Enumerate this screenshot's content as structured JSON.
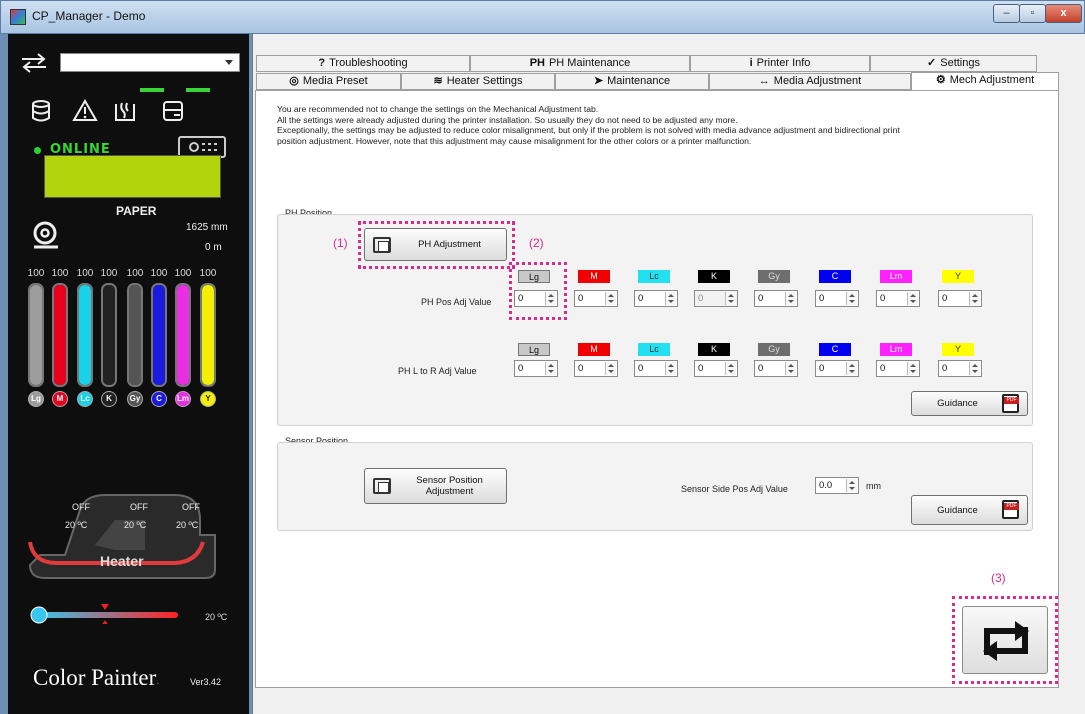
{
  "window": {
    "title": "CP_Manager - Demo",
    "close_glyph": "x",
    "min_glyph": "–",
    "max_glyph": "▫"
  },
  "left_panel": {
    "status": "ONLINE",
    "media_label": "PAPER",
    "media_length": "1625  mm",
    "media_remaining": "0  m",
    "inks": [
      {
        "code": "Lg",
        "level": "100",
        "color": "#9c9c9c",
        "fraction": 1.0
      },
      {
        "code": "M",
        "level": "100",
        "color": "#e8001c",
        "fraction": 1.0
      },
      {
        "code": "Lc",
        "level": "100",
        "color": "#19d2e8",
        "fraction": 1.0
      },
      {
        "code": "K",
        "level": "100",
        "color": "#222222",
        "fraction": 1.0
      },
      {
        "code": "Gy",
        "level": "100",
        "color": "#555555",
        "fraction": 1.0
      },
      {
        "code": "C",
        "level": "100",
        "color": "#1a1ae0",
        "fraction": 1.0
      },
      {
        "code": "Lm",
        "level": "100",
        "color": "#ea2ee4",
        "fraction": 1.0
      },
      {
        "code": "Y",
        "level": "100",
        "color": "#f2f000",
        "fraction": 1.0
      }
    ],
    "heaters": [
      {
        "state": "OFF",
        "temp": "20 ºC"
      },
      {
        "state": "OFF",
        "temp": "20 ºC"
      },
      {
        "state": "OFF",
        "temp": "20 ºC"
      }
    ],
    "heater_title": "Heater",
    "slider_temp": "20 ºC",
    "logo": "Color Painter",
    "logo_tail": ".",
    "version": "Ver3.42"
  },
  "tabs_row1": [
    {
      "label": "Troubleshooting",
      "icon": "?"
    },
    {
      "label": "PH Maintenance",
      "icon": "PH"
    },
    {
      "label": "Printer Info",
      "icon": "i"
    },
    {
      "label": "Settings",
      "icon": "✓"
    }
  ],
  "tabs_row2": [
    {
      "label": "Media Preset",
      "icon": "◎"
    },
    {
      "label": "Heater Settings",
      "icon": "≋"
    },
    {
      "label": "Maintenance",
      "icon": "➤"
    },
    {
      "label": "Media Adjustment",
      "icon": "↔"
    },
    {
      "label": "Mech Adjustment",
      "icon": "⚙"
    }
  ],
  "notice": [
    "You are recommended not to change the settings on the Mechanical Adjustment tab.",
    "All the settings were already adjusted during the printer installation. So usually they do not need to be adjusted any more.",
    "Exceptionally, the settings may be adjusted to reduce color misalignment, but only if the problem is not solved with media advance adjustment and bidirectional print",
    "position adjustment. However, note that this adjustment may cause misalignment for the other colors or a printer malfunction."
  ],
  "ph_position": {
    "title": "PH Position",
    "adjust_button": "PH Adjustment",
    "colors": [
      {
        "code": "Lg",
        "bg": "#c8c8c8",
        "fg": "#111111"
      },
      {
        "code": "M",
        "bg": "#f00000",
        "fg": "#ffffff"
      },
      {
        "code": "Lc",
        "bg": "#22e0f0",
        "fg": "#333333"
      },
      {
        "code": "K",
        "bg": "#000000",
        "fg": "#ffffff"
      },
      {
        "code": "Gy",
        "bg": "#6e6e6e",
        "fg": "#dddddd"
      },
      {
        "code": "C",
        "bg": "#0000f0",
        "fg": "#ffffff"
      },
      {
        "code": "Lm",
        "bg": "#ff22ff",
        "fg": "#ffffff"
      },
      {
        "code": "Y",
        "bg": "#ffff00",
        "fg": "#333333"
      }
    ],
    "pos_label": "PH Pos Adj Value",
    "pos_values": [
      "0",
      "0",
      "0",
      "0",
      "0",
      "0",
      "0",
      "0"
    ],
    "pos_disabled": [
      false,
      false,
      false,
      true,
      false,
      false,
      false,
      false
    ],
    "lr_label": "PH L to R Adj Value",
    "lr_values": [
      "0",
      "0",
      "0",
      "0",
      "0",
      "0",
      "0",
      "0"
    ],
    "guidance": "Guidance"
  },
  "sensor_position": {
    "title": "Sensor Position",
    "adjust_button_line1": "Sensor Position",
    "adjust_button_line2": "Adjustment",
    "side_label": "Sensor Side Pos Adj Value",
    "side_value": "0.0",
    "unit": "mm",
    "guidance": "Guidance"
  },
  "callouts": {
    "c1": "(1)",
    "c2": "(2)",
    "c3": "(3)"
  },
  "pdf_badge": "PDF"
}
